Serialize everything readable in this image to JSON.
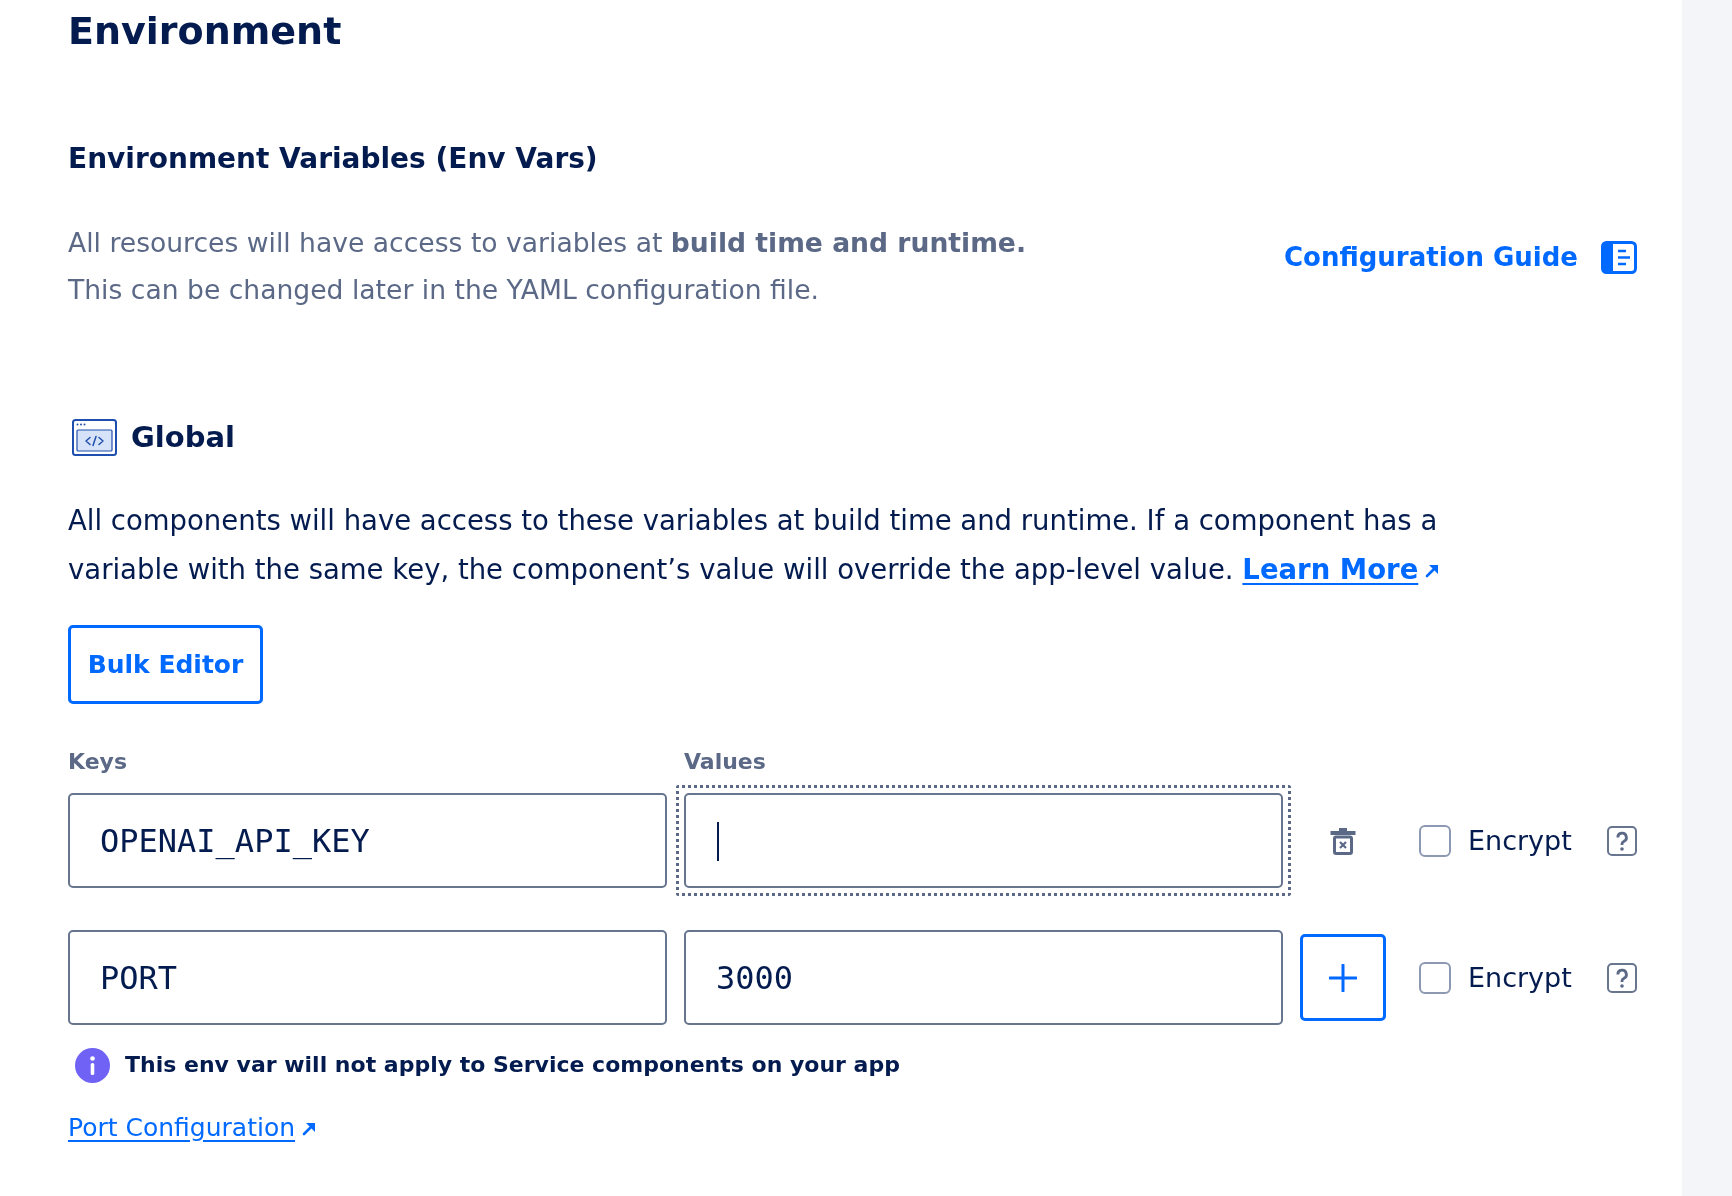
{
  "page_title": "Environment",
  "env_vars": {
    "title": "Environment Variables (Env Vars)",
    "description": [
      "All resources will have access to variables at **build time and runtime.**",
      "This can be changed later in the YAML configuration file."
    ],
    "guide_link": "Configuration Guide"
  },
  "global": {
    "title": "Global",
    "description": "All components will have access to these variables at build time and runtime. If a component has a variable with the same key, the component’s value will override the app-level value.",
    "learn_more_link": "Learn More",
    "bulk_editor_button": "Bulk Editor",
    "columns": [
      "Keys",
      "Values"
    ],
    "rows": [
      {
        "key": "OPENAI_API_KEY",
        "focused": true,
        "kind": "delete",
        "encrypted": false,
        "encrypt_label": "Encrypt"
      },
      {
        "key": "PORT",
        "value": "3000",
        "focused": false,
        "kind": "add",
        "encrypted": false,
        "encrypt_label": "Encrypt",
        "notice": "This env var will not apply to Service components on your app",
        "notice_link": "Port Configuration"
      }
    ]
  }
}
